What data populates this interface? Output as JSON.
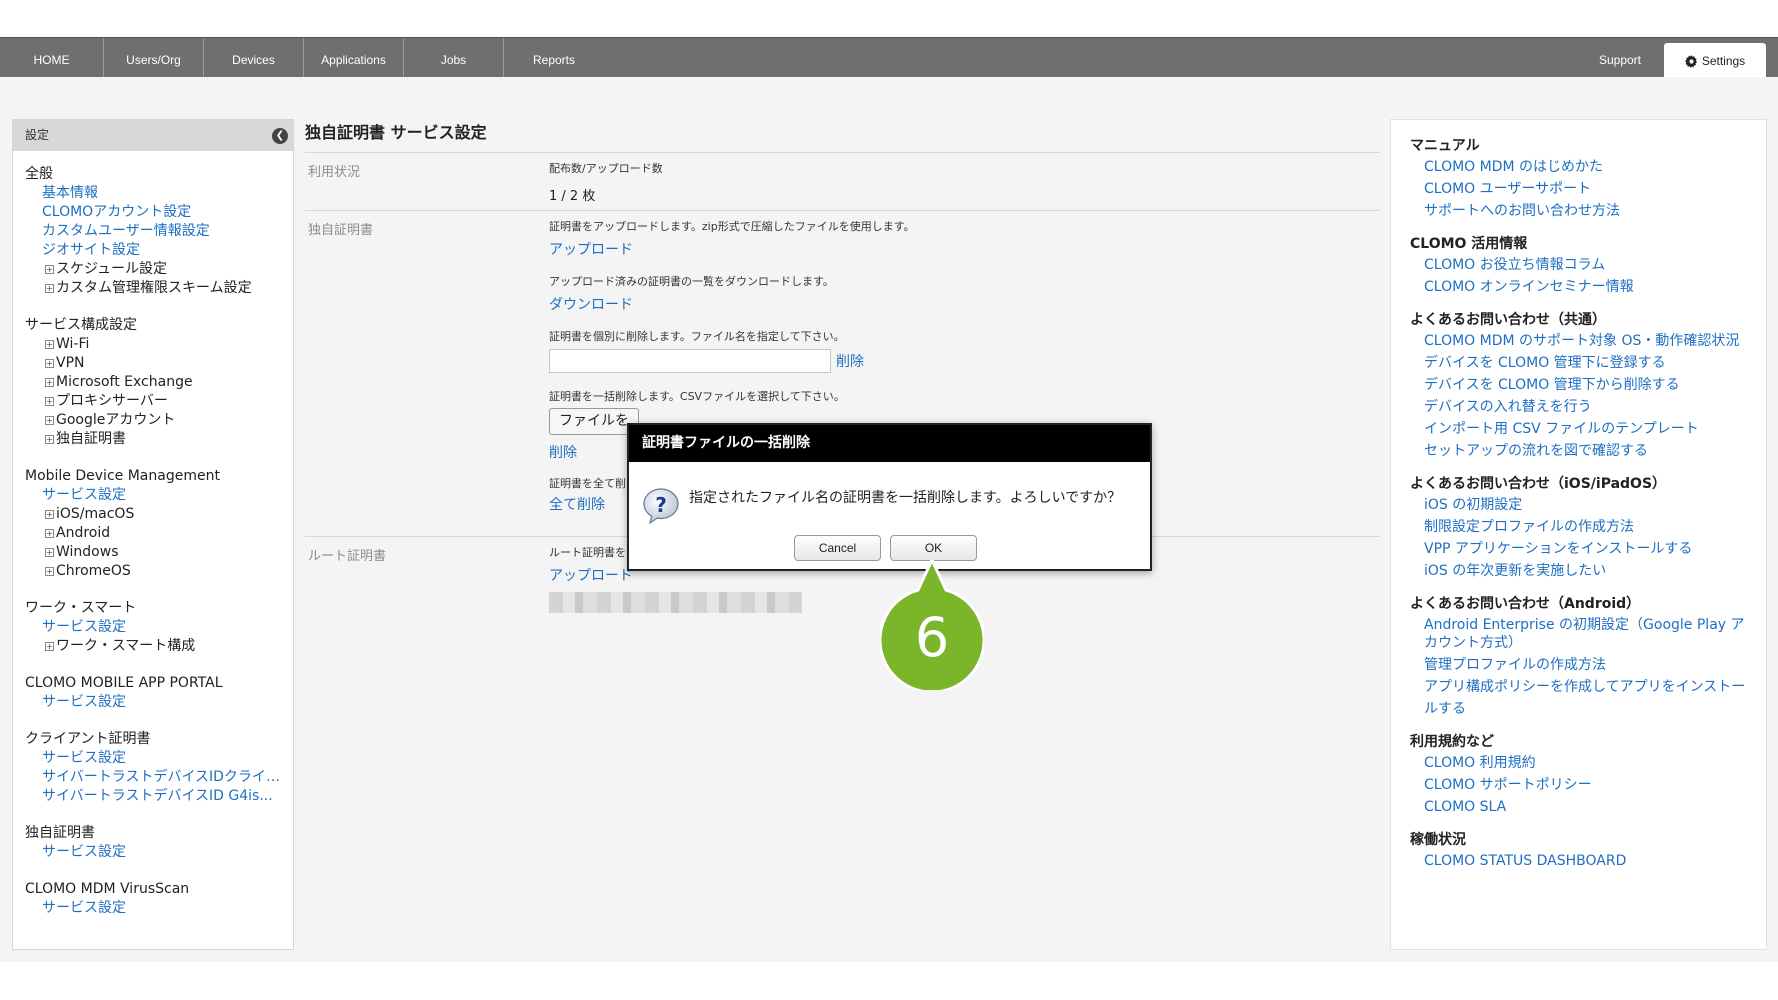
{
  "nav": {
    "items": [
      "HOME",
      "Users/Org",
      "Devices",
      "Applications",
      "Jobs",
      "Reports"
    ],
    "support": "Support",
    "settings": "Settings"
  },
  "sidebar": {
    "header": "設定",
    "groups": [
      {
        "title": "全般",
        "links": [
          "基本情報",
          "CLOMOアカウント設定",
          "カスタムユーザー情報設定",
          "ジオサイト設定"
        ],
        "expandables": [
          "スケジュール設定",
          "カスタム管理権限スキーム設定"
        ]
      },
      {
        "title": "サービス構成設定",
        "links": [],
        "expandables": [
          "Wi-Fi",
          "VPN",
          "Microsoft Exchange",
          "プロキシサーバー",
          "Googleアカウント",
          "独自証明書"
        ]
      },
      {
        "title": "Mobile Device Management",
        "links": [
          "サービス設定"
        ],
        "expandables": [
          "iOS/macOS",
          "Android",
          "Windows",
          "ChromeOS"
        ]
      },
      {
        "title": "ワーク・スマート",
        "links": [
          "サービス設定"
        ],
        "expandables": [
          "ワーク・スマート構成"
        ]
      },
      {
        "title": "CLOMO MOBILE APP PORTAL",
        "links": [
          "サービス設定"
        ],
        "expandables": []
      },
      {
        "title": "クライアント証明書",
        "links": [
          "サービス設定",
          "サイバートラストデバイスIDクライアント証明書",
          "サイバートラストデバイスID G4is..."
        ],
        "expandables": []
      },
      {
        "title": "独自証明書",
        "links": [
          "サービス設定"
        ],
        "expandables": []
      },
      {
        "title": "CLOMO MDM VirusScan",
        "links": [
          "サービス設定"
        ],
        "expandables": []
      }
    ]
  },
  "main": {
    "title": "独自証明書 サービス設定",
    "usage": {
      "label": "利用状況",
      "caption": "配布数/アップロード数",
      "value": "1 / 2 枚"
    },
    "custom_cert": {
      "label": "独自証明書",
      "upload_desc": "証明書をアップロードします。zip形式で圧縮したファイルを使用します。",
      "upload_link": "アップロード",
      "download_desc": "アップロード済みの証明書の一覧をダウンロードします。",
      "download_link": "ダウンロード",
      "delete_one_desc": "証明書を個別に削除します。ファイル名を指定して下さい。",
      "delete_one_link": "削除",
      "bulk_desc": "証明書を一括削除します。CSVファイルを選択して下さい。",
      "file_btn": "ファイルを",
      "bulk_link": "削除",
      "all_desc": "証明書を全て削",
      "all_link": "全て削除"
    },
    "root_cert": {
      "label": "ルート証明書",
      "desc": "ルート証明書を",
      "upload_link": "アップロード"
    }
  },
  "right_panel": {
    "sections": [
      {
        "title": "マニュアル",
        "links": [
          "CLOMO MDM のはじめかた",
          "CLOMO ユーザーサポート",
          "サポートへのお問い合わせ方法"
        ]
      },
      {
        "title": "CLOMO 活用情報",
        "links": [
          "CLOMO お役立ち情報コラム",
          "CLOMO オンラインセミナー情報"
        ]
      },
      {
        "title": "よくあるお問い合わせ（共通）",
        "links": [
          "CLOMO MDM のサポート対象 OS・動作確認状況",
          "デバイスを CLOMO 管理下に登録する",
          "デバイスを CLOMO 管理下から削除する",
          "デバイスの入れ替えを行う",
          "インポート用 CSV ファイルのテンプレート",
          "セットアップの流れを図で確認する"
        ]
      },
      {
        "title": "よくあるお問い合わせ（iOS/iPadOS）",
        "links": [
          "iOS の初期設定",
          "制限設定プロファイルの作成方法",
          "VPP アプリケーションをインストールする",
          "iOS の年次更新を実施したい"
        ]
      },
      {
        "title": "よくあるお問い合わせ（Android）",
        "links": [
          "Android Enterprise の初期設定（Google Play アカウント方式）",
          "管理プロファイルの作成方法",
          "アプリ構成ポリシーを作成してアプリをインストールする"
        ]
      },
      {
        "title": "利用規約など",
        "links": [
          "CLOMO 利用規約",
          "CLOMO サポートポリシー",
          "CLOMO SLA"
        ]
      },
      {
        "title": "稼働状況",
        "links": [
          "CLOMO STATUS DASHBOARD"
        ]
      }
    ]
  },
  "dialog": {
    "title": "証明書ファイルの一括削除",
    "message": "指定されたファイル名の証明書を一括削除します。よろしいですか？",
    "cancel": "Cancel",
    "ok": "OK"
  },
  "callout": {
    "number": "6",
    "color": "#7ab52a"
  }
}
